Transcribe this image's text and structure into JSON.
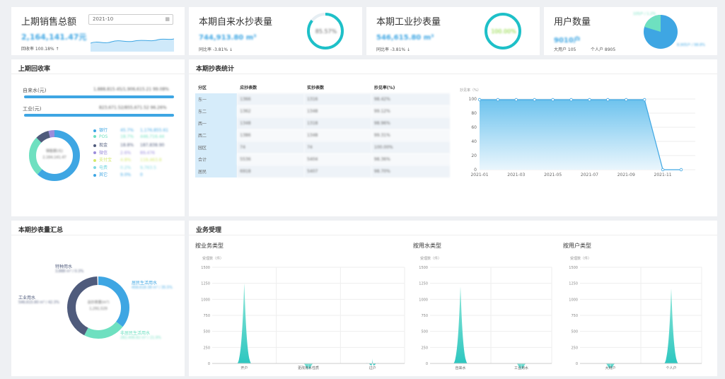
{
  "kpi": {
    "sales": {
      "title": "上期销售总额",
      "value": "2,164,141.47元",
      "sub": "回收率 100.18% ↑",
      "date": "2021-10"
    },
    "water": {
      "title": "本期自来水抄表量",
      "value": "744,913.80 m³",
      "sub": "同比率 -3.81% ↓",
      "percent": "85.57%"
    },
    "industry": {
      "title": "本期工业抄表量",
      "value": "546,615.80 m³",
      "sub": "同比率 -3.81% ↓",
      "percent": "100.00%"
    },
    "users": {
      "title": "用户数量",
      "value": "9010户",
      "sub_big": "大用户 105",
      "sub_small": "个人户 8905",
      "label_big": "105户 / 1.2%",
      "label_small": "8,905户 / 98.8%"
    }
  },
  "colors": {
    "primary": "#3ea6e3",
    "teal": "#1ec0c8",
    "green": "#7ed321",
    "navy": "#4f5b7c",
    "mint": "#6ee0c0"
  },
  "recovery": {
    "title": "上期回收率",
    "water_label": "自来水(元)",
    "water_value": "1,888,815.45/1,906,615.21  99.08%",
    "industry_label": "工业(元)",
    "industry_value": "823,671.52/855,671.52  96.26%",
    "center_title": "销售额(元)",
    "center_value": "2,164,141.47",
    "legend": [
      {
        "name": "银行",
        "pct": "45.7%",
        "amount": "1,176,855.61",
        "color": "#3ea6e3"
      },
      {
        "name": "POS",
        "pct": "18.7%",
        "amount": "446,716.44",
        "color": "#6ee0c0"
      },
      {
        "name": "现金",
        "pct": "18.8%",
        "amount": "187,838.90",
        "color": "#4f5b7c"
      },
      {
        "name": "微信",
        "pct": "2.6%",
        "amount": "89,476",
        "color": "#9b8cdb"
      },
      {
        "name": "支付宝",
        "pct": "4.8%",
        "amount": "119,463.8",
        "color": "#d4e86a"
      },
      {
        "name": "电费",
        "pct": "0.2%",
        "amount": "9,763.5",
        "color": "#7fd9e3"
      },
      {
        "name": "其它",
        "pct": "9.0%",
        "amount": "0",
        "color": "#3ea6e3"
      }
    ]
  },
  "stats": {
    "title": "本期抄表统计",
    "headers": [
      "分区",
      "应抄表数",
      "实抄表数",
      "抄见率(%)"
    ],
    "rows": [
      [
        "东一",
        "1366",
        "1316",
        "98.42%"
      ],
      [
        "东二",
        "1362",
        "1348",
        "99.12%"
      ],
      [
        "西一",
        "1348",
        "1318",
        "98.96%"
      ],
      [
        "西二",
        "1386",
        "1348",
        "99.31%"
      ],
      [
        "园区",
        "74",
        "74",
        "100.00%"
      ],
      [
        "合计",
        "5536",
        "5404",
        "98.36%"
      ],
      [
        "居民",
        "6918",
        "5407",
        "98.70%"
      ]
    ],
    "chart": {
      "ylabel": "抄见率（%）",
      "yticks": [
        "100",
        "80",
        "60",
        "40",
        "20",
        "0"
      ],
      "xticks": [
        "2021-01",
        "2021-03",
        "2021-05",
        "2021-07",
        "2021-09",
        "2021-11"
      ]
    }
  },
  "summary": {
    "title": "本期抄表量汇总",
    "center_title": "总抄表量(m³)",
    "center_value": "1,291,529",
    "labels": [
      {
        "name": "特种用水",
        "value": "3,888 m³ / 0.3%",
        "color": "#4f5b7c"
      },
      {
        "name": "居民生活用水",
        "value": "458,618.38 m³ / 35.5%",
        "color": "#3ea6e3"
      },
      {
        "name": "工业用水",
        "value": "546,615.80 m³ / 42.3%",
        "color": "#4f5b7c"
      },
      {
        "name": "非居民生活用水",
        "value": "282,406.82 m³ / 21.9%",
        "color": "#6ee0c0"
      }
    ]
  },
  "business": {
    "title": "业务受理",
    "charts": [
      {
        "title": "按业务类型",
        "ylabel": "受理数（件）",
        "yticks": [
          "1500",
          "1250",
          "1000",
          "750",
          "500",
          "250",
          "0"
        ],
        "xlabels": [
          "开户",
          "更改用水性质",
          "过户"
        ]
      },
      {
        "title": "按用水类型",
        "ylabel": "受理数（件）",
        "yticks": [
          "1500",
          "1250",
          "1000",
          "750",
          "500",
          "250",
          "0"
        ],
        "xlabels": [
          "自来水",
          "工业用水"
        ]
      },
      {
        "title": "按用户类型",
        "ylabel": "受理数（件）",
        "yticks": [
          "1500",
          "1250",
          "1000",
          "750",
          "500",
          "250",
          "0"
        ],
        "xlabels": [
          "大用户",
          "个人户"
        ]
      }
    ]
  },
  "chart_data": [
    {
      "type": "area",
      "title": "",
      "ylabel": "抄见率（%）",
      "x": [
        "2021-01",
        "2021-02",
        "2021-03",
        "2021-04",
        "2021-05",
        "2021-06",
        "2021-07",
        "2021-08",
        "2021-09",
        "2021-10",
        "2021-11",
        "2021-12"
      ],
      "values": [
        99,
        99,
        99,
        99,
        99,
        99,
        99,
        99,
        99,
        99,
        0,
        0
      ],
      "ylim": [
        0,
        100
      ]
    },
    {
      "type": "area",
      "title": "按业务类型",
      "categories": [
        "开户",
        "更改用水性质",
        "过户"
      ],
      "values": [
        1250,
        5,
        80
      ],
      "ylim": [
        0,
        1500
      ]
    },
    {
      "type": "area",
      "title": "按用水类型",
      "categories": [
        "自来水",
        "工业用水"
      ],
      "values": [
        1200,
        5
      ],
      "ylim": [
        0,
        1500
      ]
    },
    {
      "type": "area",
      "title": "按用户类型",
      "categories": [
        "大用户",
        "个人户"
      ],
      "values": [
        20,
        1170
      ],
      "ylim": [
        0,
        1500
      ]
    }
  ]
}
